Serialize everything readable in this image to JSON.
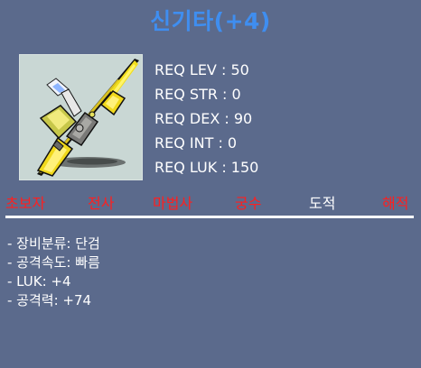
{
  "item": {
    "name": "신기타(+4)",
    "icon": "guitar-weapon-icon"
  },
  "requirements": [
    {
      "label": "REQ LEV : 50"
    },
    {
      "label": "REQ STR : 0"
    },
    {
      "label": "REQ DEX : 90"
    },
    {
      "label": "REQ INT : 0"
    },
    {
      "label": "REQ LUK : 150"
    }
  ],
  "jobs": [
    {
      "label": "초보자",
      "color": "#ff1f1f"
    },
    {
      "label": "전사",
      "color": "#ff1f1f"
    },
    {
      "label": "마법사",
      "color": "#ff1f1f"
    },
    {
      "label": "궁수",
      "color": "#ff1f1f"
    },
    {
      "label": "도적",
      "color": "#ffffff"
    },
    {
      "label": "해적",
      "color": "#ff1f1f"
    }
  ],
  "stats": [
    {
      "label": "- 장비분류: 단검"
    },
    {
      "label": "- 공격속도: 빠름"
    },
    {
      "label": "- LUK: +4"
    },
    {
      "label": "- 공격력: +74"
    }
  ],
  "colors": {
    "background": "#5b6a8c",
    "title": "#3f8ef0",
    "job_unavailable": "#ff1f1f",
    "job_available": "#ffffff"
  }
}
